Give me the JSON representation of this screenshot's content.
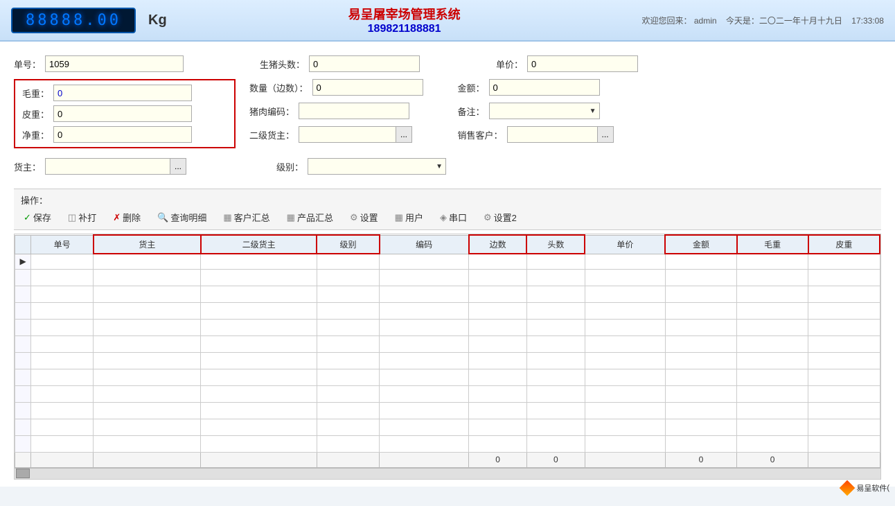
{
  "header": {
    "lcd_value": "88888.00",
    "kg_label": "Kg",
    "system_title": "易呈屠宰场管理系统",
    "phone": "189821188881",
    "welcome": "欢迎您回来：",
    "user": "admin",
    "date_label": "今天是：二〇二一年十月十九日",
    "time": "17:33:08"
  },
  "form": {
    "order_label": "单号：",
    "order_value": "1059",
    "pigs_label": "生猪头数：",
    "pigs_value": "0",
    "unit_price_label": "单价：",
    "unit_price_value": "0",
    "gross_weight_label": "毛重：",
    "gross_weight_value": "0",
    "quantity_label": "数量（边数）：",
    "quantity_value": "0",
    "amount_label": "金额：",
    "amount_value": "0",
    "tare_label": "皮重：",
    "tare_value": "0",
    "pork_code_label": "猪肉编码：",
    "pork_code_value": "",
    "note_label": "备注：",
    "note_value": "",
    "net_weight_label": "净重：",
    "net_weight_value": "0",
    "secondary_owner_label": "二级货主：",
    "secondary_owner_value": "",
    "sales_customer_label": "销售客户：",
    "sales_customer_value": "",
    "owner_label": "货主：",
    "owner_value": "",
    "level_label": "级别：",
    "level_value": ""
  },
  "operations": {
    "label": "操作：",
    "buttons": [
      {
        "id": "save",
        "icon": "✓",
        "label": "保存",
        "class": "op-save"
      },
      {
        "id": "reprint",
        "icon": "◫",
        "label": "补打",
        "class": "op-reprint"
      },
      {
        "id": "delete",
        "icon": "✗",
        "label": "删除",
        "class": "op-delete"
      },
      {
        "id": "query",
        "icon": "🔍",
        "label": "查询明细",
        "class": "op-query"
      },
      {
        "id": "customer-summary",
        "icon": "▦",
        "label": "客户汇总",
        "class": "op-customer"
      },
      {
        "id": "product-summary",
        "icon": "▦",
        "label": "产品汇总",
        "class": "op-product"
      },
      {
        "id": "settings",
        "icon": "⚙",
        "label": "设置",
        "class": "op-settings"
      },
      {
        "id": "user",
        "icon": "▦",
        "label": "用户",
        "class": "op-user"
      },
      {
        "id": "port",
        "icon": "◈",
        "label": "串口",
        "class": "op-port"
      },
      {
        "id": "settings2",
        "icon": "⚙",
        "label": "设置2",
        "class": "op-settings2"
      }
    ]
  },
  "table": {
    "columns": [
      {
        "id": "sn",
        "label": "单号",
        "highlight": false
      },
      {
        "id": "owner",
        "label": "货主",
        "highlight": true
      },
      {
        "id": "owner2",
        "label": "二级货主",
        "highlight": true
      },
      {
        "id": "level",
        "label": "级别",
        "highlight": true
      },
      {
        "id": "code",
        "label": "编码",
        "highlight": false
      },
      {
        "id": "sides",
        "label": "边数",
        "highlight": true
      },
      {
        "id": "heads",
        "label": "头数",
        "highlight": true
      },
      {
        "id": "unit_price",
        "label": "单价",
        "highlight": false
      },
      {
        "id": "amount",
        "label": "金额",
        "highlight": true
      },
      {
        "id": "gross",
        "label": "毛重",
        "highlight": true
      },
      {
        "id": "tare",
        "label": "皮重",
        "highlight": true
      }
    ],
    "rows": [],
    "footer": {
      "sides_total": "0",
      "heads_total": "0",
      "amount_total": "0",
      "gross_total": "0"
    }
  },
  "logo": {
    "text": "易呈软件",
    "extra": "("
  }
}
